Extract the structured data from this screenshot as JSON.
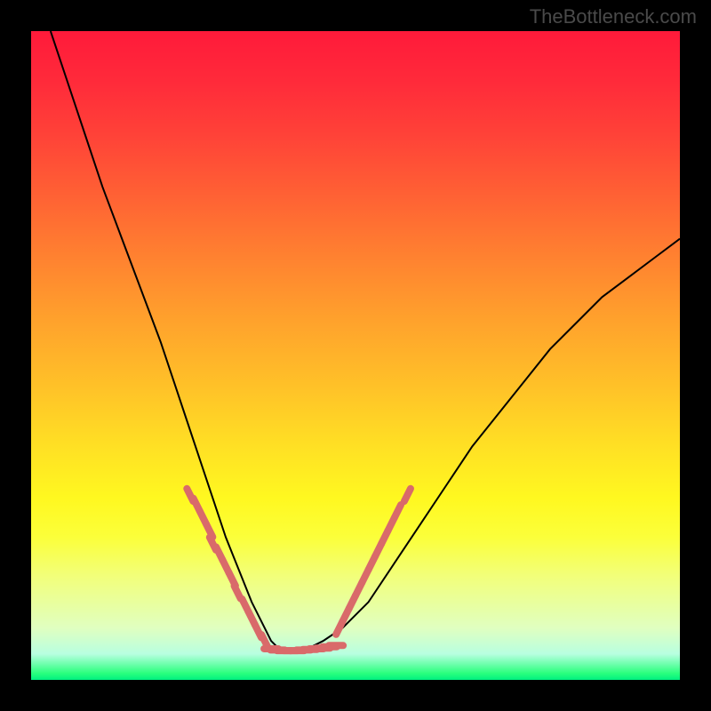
{
  "watermark": "TheBottleneck.com",
  "chart_data": {
    "type": "line",
    "title": "",
    "xlabel": "",
    "ylabel": "",
    "xlim": [
      0,
      100
    ],
    "ylim": [
      0,
      100
    ],
    "series": [
      {
        "name": "bottleneck-curve",
        "color": "#000000",
        "x": [
          3,
          5,
          8,
          11,
          14,
          17,
          20,
          22,
          24,
          26,
          28,
          30,
          32,
          34,
          36,
          37,
          38,
          39,
          41,
          43,
          45,
          48,
          52,
          56,
          60,
          64,
          68,
          72,
          76,
          80,
          84,
          88,
          92,
          96,
          100
        ],
        "y": [
          100,
          94,
          85,
          76,
          68,
          60,
          52,
          46,
          40,
          34,
          28,
          22,
          17,
          12,
          8,
          6,
          5,
          4.5,
          4.5,
          5,
          6,
          8,
          12,
          18,
          24,
          30,
          36,
          41,
          46,
          51,
          55,
          59,
          62,
          65,
          68
        ]
      },
      {
        "name": "left-markers",
        "color": "#d96a6a",
        "type": "scatter",
        "x": [
          24.5,
          25.5,
          26.5,
          27.5,
          28.0,
          29.0,
          30.0,
          31.0,
          31.8,
          33.0,
          34.0,
          35.0,
          36.0
        ],
        "y": [
          28.5,
          27.0,
          25.0,
          23.0,
          21.0,
          19.5,
          17.5,
          15.5,
          13.5,
          11.5,
          9.5,
          7.5,
          6.0
        ]
      },
      {
        "name": "valley-markers",
        "color": "#d96a6a",
        "type": "scatter",
        "x": [
          37.0,
          38.0,
          39.0,
          40.0,
          41.0,
          42.0,
          43.0,
          44.0,
          45.0,
          46.0,
          47.0
        ],
        "y": [
          4.8,
          4.6,
          4.5,
          4.5,
          4.5,
          4.6,
          4.7,
          4.8,
          4.9,
          5.1,
          5.3
        ]
      },
      {
        "name": "right-markers",
        "color": "#d96a6a",
        "type": "scatter",
        "x": [
          47.5,
          48.5,
          49.5,
          50.5,
          51.5,
          52.5,
          53.5,
          54.5,
          55.5,
          56.5,
          58.0
        ],
        "y": [
          8.0,
          10.0,
          12.0,
          14.0,
          16.0,
          18.0,
          20.0,
          22.0,
          24.0,
          26.0,
          28.5
        ]
      }
    ],
    "gradient_background": {
      "type": "vertical",
      "stops": [
        {
          "pos": 0,
          "color": "#ff1a3a"
        },
        {
          "pos": 50,
          "color": "#ffc228"
        },
        {
          "pos": 75,
          "color": "#fff820"
        },
        {
          "pos": 100,
          "color": "#00f080"
        }
      ]
    }
  }
}
